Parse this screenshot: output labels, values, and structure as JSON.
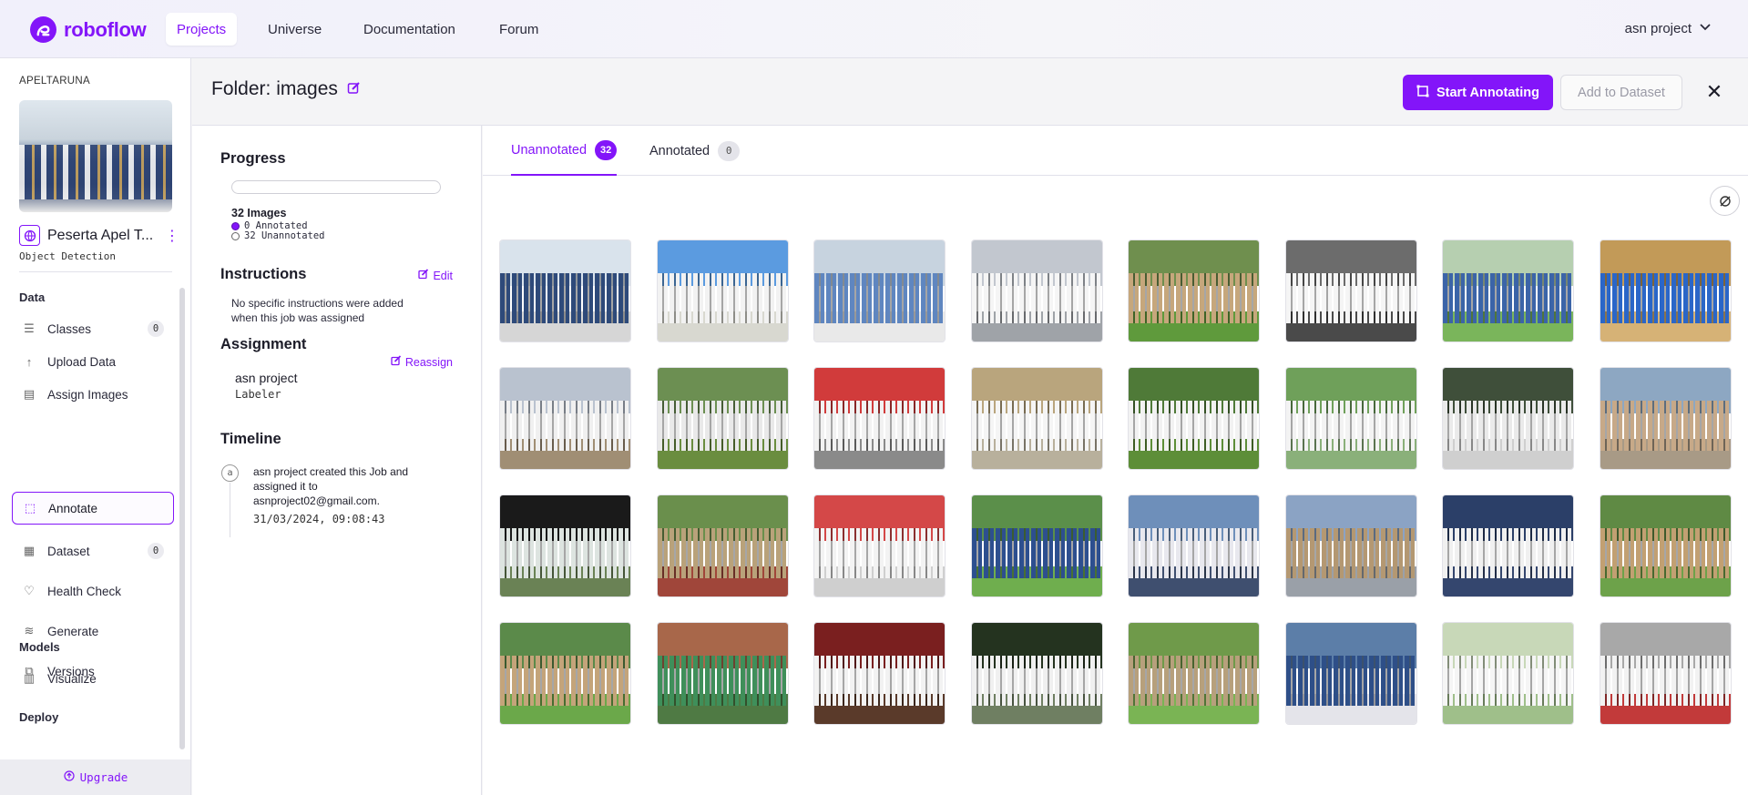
{
  "nav": {
    "brand": "roboflow",
    "tabs": [
      "Projects",
      "Universe",
      "Documentation",
      "Forum"
    ],
    "active_tab": "Projects",
    "project_menu": "asn project"
  },
  "sidebar": {
    "workspace": "APELTARUNA",
    "project_name": "Peserta Apel T...",
    "project_type": "Object Detection",
    "sections": {
      "data": "Data",
      "models": "Models",
      "deploy": "Deploy"
    },
    "items": [
      {
        "label": "Classes",
        "icon": "list-icon",
        "count": "0"
      },
      {
        "label": "Upload Data",
        "icon": "upload-icon"
      },
      {
        "label": "Assign Images",
        "icon": "assign-icon"
      },
      {
        "label": "Annotate",
        "icon": "annotate-icon",
        "active": true
      },
      {
        "label": "Dataset",
        "icon": "dataset-icon",
        "count": "0"
      },
      {
        "label": "Health Check",
        "icon": "heart-icon"
      },
      {
        "label": "Generate",
        "icon": "stack-icon"
      },
      {
        "label": "Versions",
        "icon": "versions-icon"
      },
      {
        "label": "Visualize",
        "icon": "chart-icon"
      }
    ],
    "upgrade": "Upgrade"
  },
  "header": {
    "folder_title": "Folder: images",
    "start_annotating": "Start Annotating",
    "add_to_dataset": "Add to Dataset"
  },
  "panel": {
    "progress_title": "Progress",
    "progress_fraction": 0,
    "images_count": "32 Images",
    "annotated_legend": "0 Annotated",
    "unannotated_legend": "32 Unannotated",
    "instructions_title": "Instructions",
    "edit_label": "Edit",
    "instructions_text_1": "No specific instructions were added",
    "instructions_text_2": "when this job was assigned",
    "assignment_title": "Assignment",
    "reassign_label": "Reassign",
    "assignee": "asn project",
    "assignee_role": "Labeler",
    "timeline_title": "Timeline",
    "timeline_avatar": "a",
    "timeline_line_1": "asn project created this Job and",
    "timeline_line_2": "assigned it to",
    "timeline_line_3": "asnproject02@gmail.com.",
    "timeline_date": "31/03/2024, 09:08:43"
  },
  "gallery": {
    "tab_unannotated": "Unannotated",
    "tab_unannotated_count": "32",
    "tab_annotated": "Annotated",
    "tab_annotated_count": "0",
    "images": [
      {
        "sky": "#d9e3ec",
        "people": "#2e4a7a",
        "ground": "#d6d6d6"
      },
      {
        "sky": "#5b9be0",
        "people": "#f2f2f2",
        "ground": "#d8d8d0"
      },
      {
        "sky": "#c7d3df",
        "people": "#5f86c0",
        "ground": "#e9e9e9"
      },
      {
        "sky": "#c2c7cf",
        "people": "#f5f5f5",
        "ground": "#9fa3a8"
      },
      {
        "sky": "#6f8f4e",
        "people": "#c6a77c",
        "ground": "#5f9a3c"
      },
      {
        "sky": "#6c6c6c",
        "people": "#f5f5f5",
        "ground": "#4a4a4a"
      },
      {
        "sky": "#b6cfb0",
        "people": "#3b64a8",
        "ground": "#7ab55b"
      },
      {
        "sky": "#c29a58",
        "people": "#2a66c8",
        "ground": "#d6b276"
      },
      {
        "sky": "#b9c2cf",
        "people": "#f0f0f0",
        "ground": "#a08e74"
      },
      {
        "sky": "#6c8f52",
        "people": "#e9e9e9",
        "ground": "#6a8d3f"
      },
      {
        "sky": "#d13b3b",
        "people": "#f2f2f2",
        "ground": "#8a8a8a"
      },
      {
        "sky": "#b9a57d",
        "people": "#f5f5f5",
        "ground": "#b8b09c"
      },
      {
        "sky": "#4f7a38",
        "people": "#f2f2f2",
        "ground": "#5d8e38"
      },
      {
        "sky": "#6fa05a",
        "people": "#f3f3f3",
        "ground": "#8ab07a"
      },
      {
        "sky": "#3f4f3a",
        "people": "#eaeaea",
        "ground": "#cfcfcf"
      },
      {
        "sky": "#8da7c2",
        "people": "#c7a988",
        "ground": "#a89a86"
      },
      {
        "sky": "#1a1a1a",
        "people": "#dde4e0",
        "ground": "#6a8255"
      },
      {
        "sky": "#6a8f4c",
        "people": "#b9a27a",
        "ground": "#a0463a"
      },
      {
        "sky": "#d44848",
        "people": "#f3f3f3",
        "ground": "#cfcfcf"
      },
      {
        "sky": "#5b8f4a",
        "people": "#2d4f8f",
        "ground": "#6fae4e"
      },
      {
        "sky": "#6e8fba",
        "people": "#e8e8ee",
        "ground": "#3f4f6f"
      },
      {
        "sky": "#8ba3c4",
        "people": "#b49872",
        "ground": "#9aa0a8"
      },
      {
        "sky": "#2b3f68",
        "people": "#f0f0f0",
        "ground": "#34466e"
      },
      {
        "sky": "#5f8a44",
        "people": "#c2a072",
        "ground": "#6da24a"
      },
      {
        "sky": "#5b8a4a",
        "people": "#c4a47a",
        "ground": "#6ba84a"
      },
      {
        "sky": "#a8674a",
        "people": "#3f8f5a",
        "ground": "#4f7a44"
      },
      {
        "sky": "#7a1f1f",
        "people": "#f2f2f2",
        "ground": "#5a3a2a"
      },
      {
        "sky": "#24331f",
        "people": "#f0f0f0",
        "ground": "#6f7f62"
      },
      {
        "sky": "#6f9a4a",
        "people": "#b7a07c",
        "ground": "#7ab454"
      },
      {
        "sky": "#5c7ea8",
        "people": "#2e4f88",
        "ground": "#e4e4ea"
      },
      {
        "sky": "#c8d8b8",
        "people": "#f5f5f5",
        "ground": "#9fbf8a"
      },
      {
        "sky": "#a8a8a8",
        "people": "#f2f2f2",
        "ground": "#c23a3a"
      }
    ]
  }
}
